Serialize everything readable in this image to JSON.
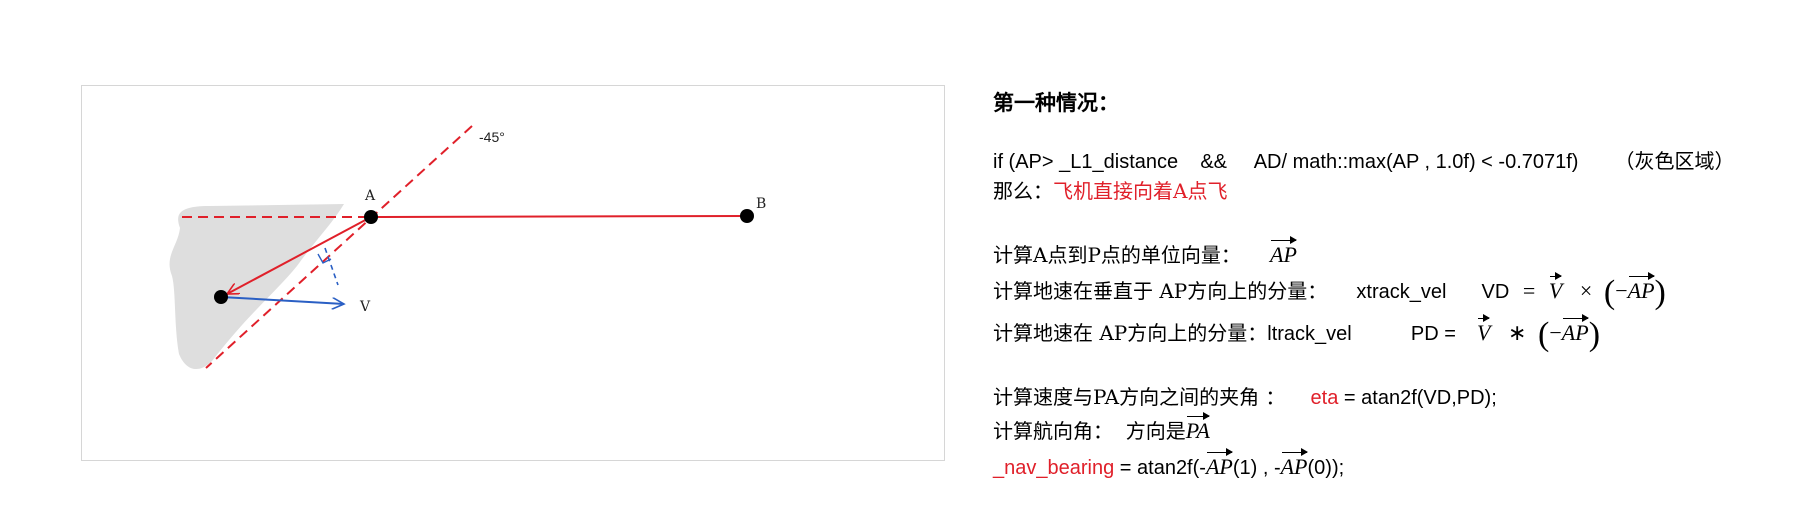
{
  "figure": {
    "labels": {
      "A": "A",
      "B": "B",
      "V": "V",
      "angle": "-45°"
    },
    "colors": {
      "red": "#e0202a",
      "blue": "#2a5fc4",
      "gray_region": "#dedede",
      "point": "#000000"
    }
  },
  "text": {
    "heading": "第一种情况：",
    "condition": {
      "code": "if (AP> _L1_distance    &&     AD/ math::max(AP , 1.0f) < -0.7071f)",
      "note": "（灰色区域）"
    },
    "then": {
      "label": "那么：",
      "action": "飞机直接向着A点飞"
    },
    "unit_vector": {
      "label": "计算A点到P点的单位向量：",
      "vec": "AP"
    },
    "xtrack": {
      "label": "计算地速在垂直于 AP方向上的分量：",
      "name": "xtrack_vel",
      "lhs": "VD",
      "eq": "=",
      "v": "V",
      "op": "×",
      "neg": "−",
      "vec": "AP"
    },
    "ltrack": {
      "label": "计算地速在 AP方向上的分量：",
      "name": "ltrack_vel",
      "lhs": "PD =",
      "v": "V",
      "op": "∗",
      "neg": "−",
      "vec": "AP"
    },
    "eta": {
      "label": "计算速度与PA方向之间的夹角  ：",
      "name": "eta",
      "expr": " = atan2f(VD,PD);"
    },
    "heading_angle": {
      "label": "计算航向角：  方向是",
      "vec": "PA"
    },
    "nav_bearing": {
      "name": "_nav_bearing",
      "expr_a": " = atan2f(-",
      "vec1": "AP",
      "idx1": "(1) , -",
      "vec2": "AP",
      "idx2": "(0));"
    }
  }
}
